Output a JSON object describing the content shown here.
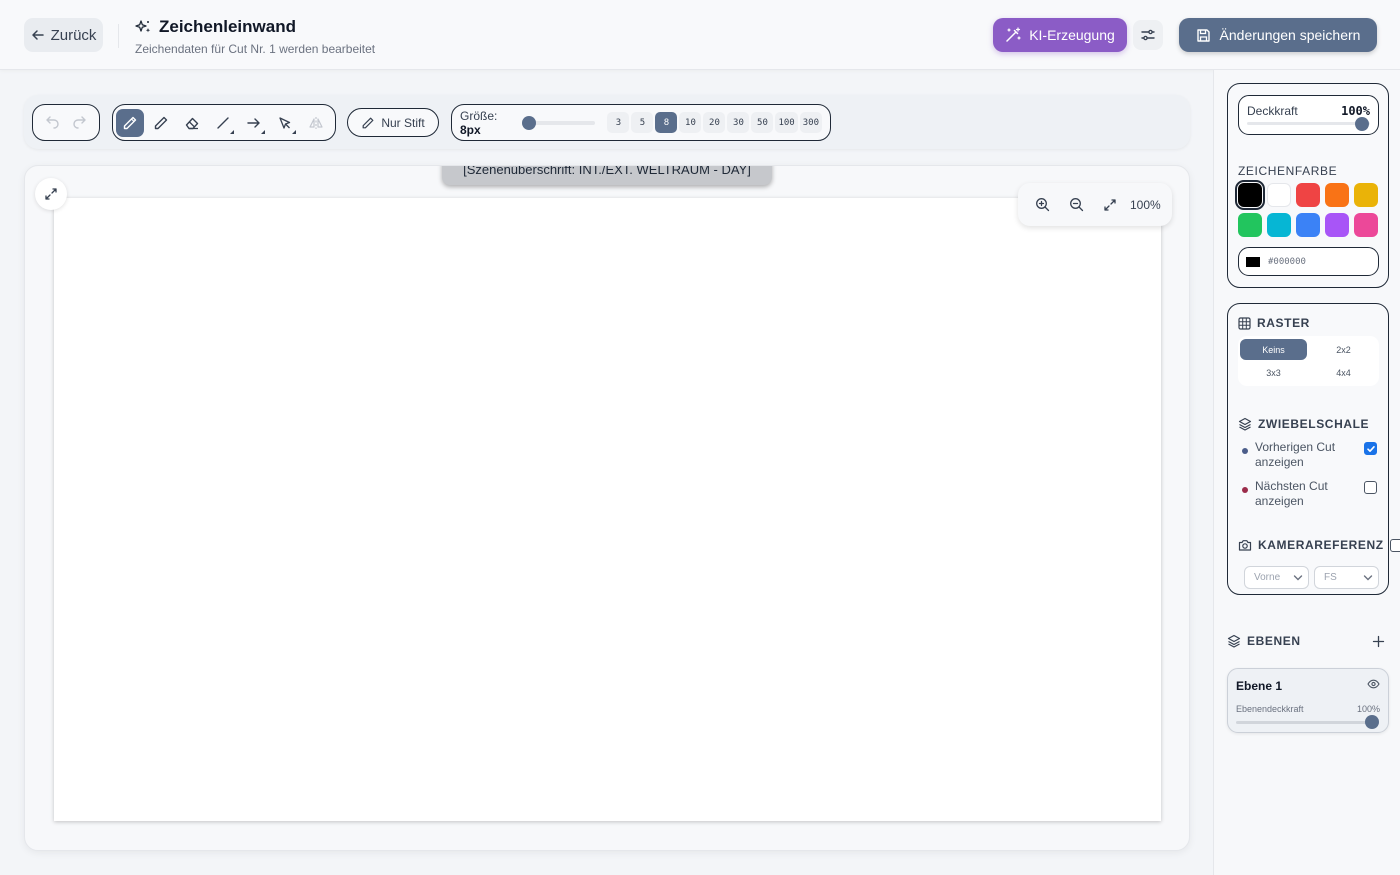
{
  "header": {
    "back_label": "Zurück",
    "title": "Zeichenleinwand",
    "subtitle": "Zeichendaten für Cut Nr. 1 werden bearbeitet",
    "ai_label": "KI-Erzeugung",
    "save_label": "Änderungen speichern",
    "accent_ai": "#8b5cc6",
    "accent_primary": "#5a6e8c"
  },
  "toolbar": {
    "tools": [
      "pen-tool",
      "pencil-tool",
      "eraser-tool",
      "line-tool",
      "arrow-tool",
      "select-tool",
      "mirror-tool"
    ],
    "active_tool": "pen-tool",
    "pen_only_label": "Nur Stift",
    "size_label": "Größe:",
    "size_value": "8px",
    "size_options": [
      "3",
      "5",
      "8",
      "10",
      "20",
      "30",
      "50",
      "100",
      "300"
    ],
    "active_size": "8"
  },
  "canvas": {
    "scene_heading": "[Szenenüberschrift: INT./EXT. WELTRAUM - DAY]",
    "zoom": "100%"
  },
  "sidebar": {
    "opacity_label": "Deckkraft",
    "opacity_value": "100%",
    "color_title": "ZEICHENFARBE",
    "colors": [
      "#000000",
      "#ffffff",
      "#ef4444",
      "#f97316",
      "#eab308",
      "#22c55e",
      "#06b6d4",
      "#3b82f6",
      "#a855f7",
      "#ec4899"
    ],
    "selected_color": "#000000",
    "hex_value": "#000000",
    "grid_title": "RASTER",
    "grid_options": [
      "Keins",
      "2x2",
      "3x3",
      "4x4"
    ],
    "grid_active": "Keins",
    "onion_title": "ZWIEBELSCHALE",
    "onion_prev_label": "Vorherigen Cut anzeigen",
    "onion_prev_checked": true,
    "onion_prev_color": "#4b5d8a",
    "onion_next_label": "Nächsten Cut anzeigen",
    "onion_next_checked": false,
    "onion_next_color": "#9b2c4a",
    "camera_title": "KAMERAREFERENZ",
    "camera_angle": "Vorne",
    "camera_shot": "FS",
    "layers_title": "EBENEN",
    "layers": [
      {
        "name": "Ebene 1",
        "opacity_label": "Ebenendeckkraft",
        "opacity_value": "100%"
      }
    ]
  }
}
